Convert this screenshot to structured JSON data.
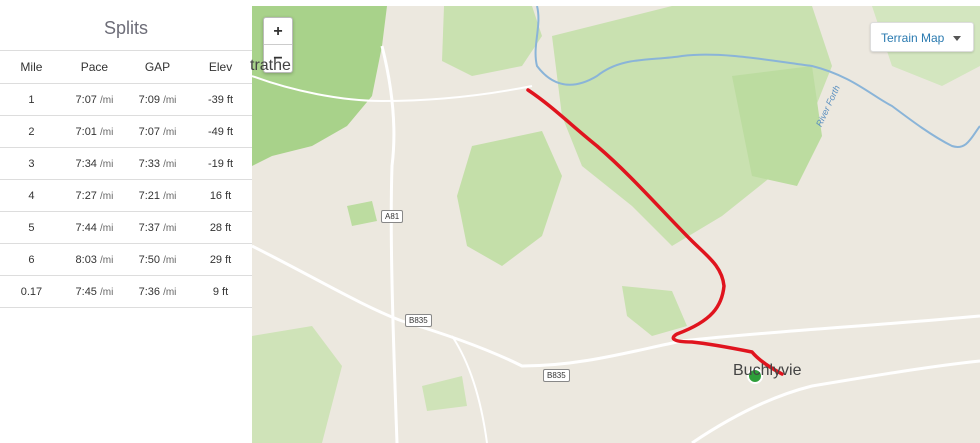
{
  "splits": {
    "title": "Splits",
    "columns": [
      "Mile",
      "Pace",
      "GAP",
      "Elev"
    ],
    "rows": [
      {
        "mile": "1",
        "pace": "7:07",
        "gap": "7:09",
        "elev": "-39 ft"
      },
      {
        "mile": "2",
        "pace": "7:01",
        "gap": "7:07",
        "elev": "-49 ft"
      },
      {
        "mile": "3",
        "pace": "7:34",
        "gap": "7:33",
        "elev": "-19 ft"
      },
      {
        "mile": "4",
        "pace": "7:27",
        "gap": "7:21",
        "elev": "16 ft"
      },
      {
        "mile": "5",
        "pace": "7:44",
        "gap": "7:37",
        "elev": "28 ft"
      },
      {
        "mile": "6",
        "pace": "8:03",
        "gap": "7:50",
        "elev": "29 ft"
      },
      {
        "mile": "0.17",
        "pace": "7:45",
        "gap": "7:36",
        "elev": "9 ft"
      }
    ],
    "pace_unit": "/mi"
  },
  "map": {
    "zoom_in": "+",
    "zoom_out": "−",
    "map_type": "Terrain Map",
    "place_labels": {
      "top_left": "trathe",
      "town": "Buchlyvie",
      "river": "River Forth"
    },
    "road_labels": {
      "a81": "A81",
      "b835_1": "B835",
      "b835_2": "B835"
    },
    "route_color": "#e0141e",
    "end_marker_color": "#2e9e3a"
  }
}
